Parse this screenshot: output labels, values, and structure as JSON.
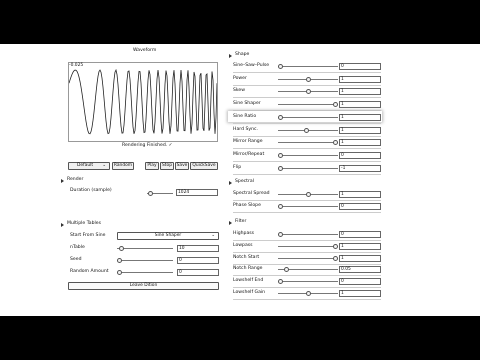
{
  "waveform": {
    "title": "Waveform",
    "overlay_value": "-0.025",
    "status": "Rendering Finished. ✓"
  },
  "transport": {
    "preset_value": "Default",
    "random_label": "Random",
    "play_label": "Play",
    "stop_label": "Stop",
    "save_label": "Save",
    "quicksave_label": "QuickSave"
  },
  "render": {
    "heading": "Render",
    "duration_label": "Duration (sample)",
    "duration_value": "1024",
    "duration_fraction": 0.03
  },
  "multiple_tables": {
    "heading": "Multiple Tables",
    "start_label": "Start From Sine",
    "start_value": "Sine Shaper",
    "rows": [
      {
        "label": "nTable",
        "value": "10",
        "fraction": 0.04
      },
      {
        "label": "Seed",
        "value": "0",
        "fraction": 0.0
      },
      {
        "label": "Random Amount",
        "value": "0",
        "fraction": 0.0
      }
    ],
    "leave_label": "Leave Dition"
  },
  "shape": {
    "heading": "Shape",
    "rows": [
      {
        "label": "Sine–Saw–Pulse",
        "value": "0",
        "fraction": 0.0
      },
      {
        "label": "Power",
        "value": "1",
        "fraction": 0.5
      },
      {
        "label": "Skew",
        "value": "1",
        "fraction": 0.5
      },
      {
        "label": "Sine Shaper",
        "value": "1",
        "fraction": 1.0
      },
      {
        "label": "Sine Ratio",
        "value": "1",
        "fraction": 0.0
      },
      {
        "label": "Hard Sync.",
        "value": "1",
        "fraction": 0.48
      },
      {
        "label": "Mirror Range",
        "value": "1",
        "fraction": 1.0
      },
      {
        "label": "Mirror/Repeat",
        "value": "0",
        "fraction": 0.0
      },
      {
        "label": "Flip",
        "value": "-1",
        "fraction": 0.0
      }
    ]
  },
  "spectral": {
    "heading": "Spectral",
    "rows": [
      {
        "label": "Spectral Spread",
        "value": "1",
        "fraction": 0.5
      },
      {
        "label": "Phase Slope",
        "value": "0",
        "fraction": 0.0
      }
    ]
  },
  "filter": {
    "heading": "Filter",
    "rows": [
      {
        "label": "Highpass",
        "value": "0",
        "fraction": 0.0
      },
      {
        "label": "Lowpass",
        "value": "1",
        "fraction": 1.0
      },
      {
        "label": "Notch Start",
        "value": "1",
        "fraction": 1.0
      },
      {
        "label": "Notch Range",
        "value": "0.05",
        "fraction": 0.1
      },
      {
        "label": "Lowshelf End",
        "value": "0",
        "fraction": 0.0
      },
      {
        "label": "Lowshelf Gain",
        "value": "1",
        "fraction": 0.5
      }
    ]
  },
  "colors": {
    "accent": "#333333",
    "highlight": "#bbbbbb"
  },
  "icons": [
    "triangle-down-icon",
    "chevron-down-icon",
    "check-icon"
  ]
}
